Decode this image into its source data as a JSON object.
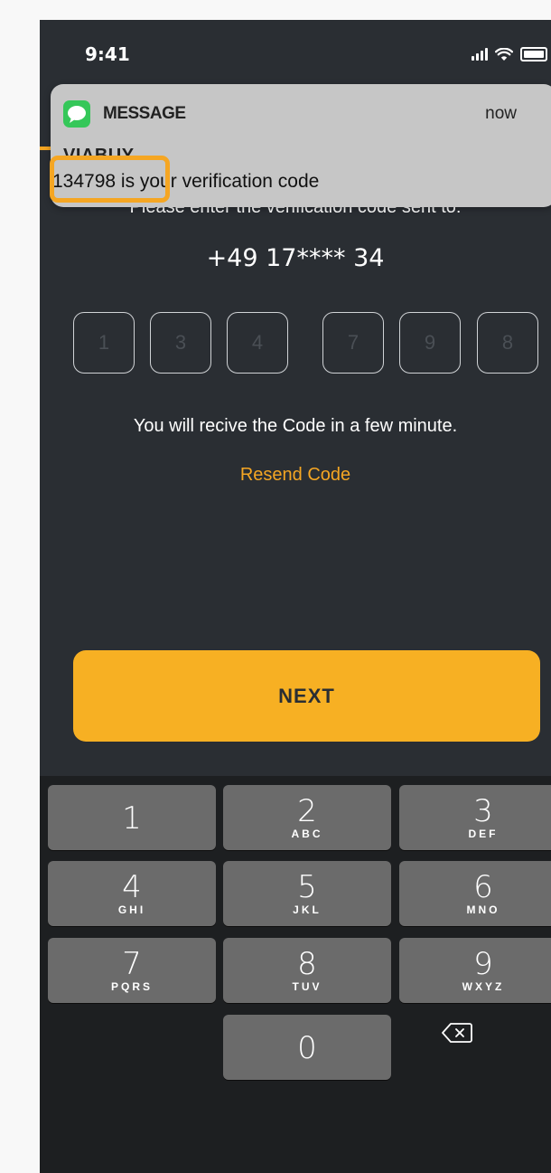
{
  "status_bar": {
    "time": "9:41",
    "signal_icon": "signal-bars-icon",
    "wifi_icon": "wifi-icon",
    "battery_icon": "battery-icon"
  },
  "verification": {
    "prompt": "Please enter the verification code sent to:",
    "phone_number": "+49 17**** 34",
    "code_digits": [
      "1",
      "3",
      "4",
      "7",
      "9",
      "8"
    ],
    "hint": "You will recive the Code in a few minute.",
    "resend_label": "Resend Code"
  },
  "next_label": "NEXT",
  "keyboard": {
    "keys": [
      {
        "digit": "1",
        "letters": ""
      },
      {
        "digit": "2",
        "letters": "ABC"
      },
      {
        "digit": "3",
        "letters": "DEF"
      },
      {
        "digit": "4",
        "letters": "GHI"
      },
      {
        "digit": "5",
        "letters": "JKL"
      },
      {
        "digit": "6",
        "letters": "MNO"
      },
      {
        "digit": "7",
        "letters": "PQRS"
      },
      {
        "digit": "8",
        "letters": "TUV"
      },
      {
        "digit": "9",
        "letters": "WXYZ"
      },
      {
        "digit": "0",
        "letters": ""
      }
    ],
    "delete_icon": "backspace-icon"
  },
  "notification": {
    "app_name": "MESSAGE",
    "time": "now",
    "sender": "VIABUY",
    "body": "134798 is your verification code",
    "app_icon": "message-bubble-icon"
  },
  "colors": {
    "accent": "#f7b023",
    "background": "#2a2e33",
    "keyboard_bg": "#1d1f21",
    "key_bg": "#6b6b6b"
  }
}
